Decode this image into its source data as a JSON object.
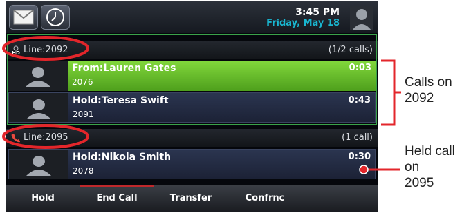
{
  "status_bar": {
    "time": "3:45 PM",
    "date": "Friday, May 18"
  },
  "lines": [
    {
      "label": "Line:2092",
      "count": "(1/2 calls)",
      "calls": [
        {
          "name": "From:Lauren Gates",
          "number": "2076",
          "duration": "0:03",
          "state": "active"
        },
        {
          "name": "Hold:Teresa Swift",
          "number": "2091",
          "duration": "0:43",
          "state": "held"
        }
      ]
    },
    {
      "label": "Line:2095",
      "count": "(1 call)",
      "calls": [
        {
          "name": "Hold:Nikola Smith",
          "number": "2078",
          "duration": "0:30",
          "state": "held"
        }
      ]
    }
  ],
  "softkeys": [
    "Hold",
    "End Call",
    "Transfer",
    "Confrnc",
    ""
  ],
  "annotations": {
    "calls_on_line": [
      "Calls on",
      "2092"
    ],
    "held_call": [
      "Held call",
      "on",
      "2095"
    ]
  },
  "colors": {
    "accent_green": "#5cb82a",
    "annotation_red": "#e3262b",
    "date_cyan": "#19b6d0"
  },
  "icons": {
    "hd": "hd-audio-icon",
    "handset": "handset-icon",
    "messages": "envelope-icon",
    "history": "clock-icon",
    "contact": "person-silhouette-icon"
  }
}
